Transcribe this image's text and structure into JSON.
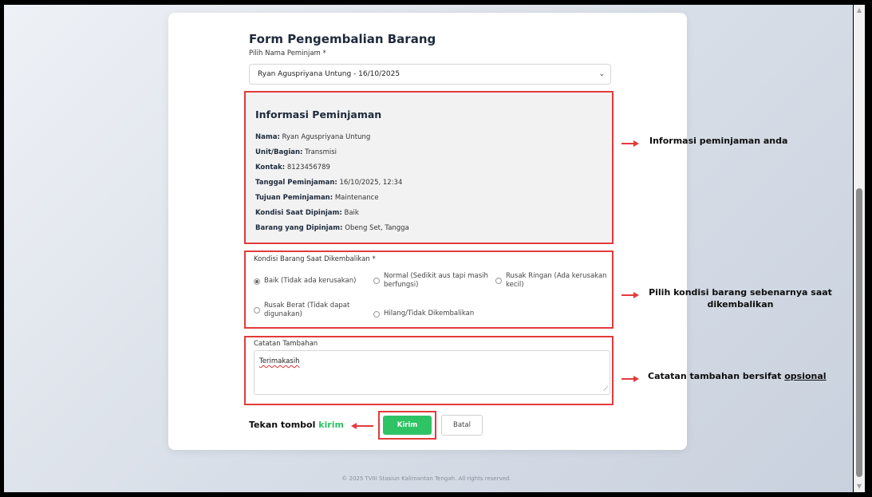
{
  "form": {
    "title": "Form Pengembalian Barang",
    "borrower_label": "Pilih Nama Peminjam *",
    "borrower_selected": "Ryan Aguspriyana Untung - 16/10/2025"
  },
  "info": {
    "title": "Informasi Peminjaman",
    "rows": [
      {
        "label": "Nama:",
        "value": " Ryan Aguspriyana Untung"
      },
      {
        "label": "Unit/Bagian:",
        "value": " Transmisi"
      },
      {
        "label": "Kontak:",
        "value": " 8123456789"
      },
      {
        "label": "Tanggal Peminjaman:",
        "value": " 16/10/2025, 12:34"
      },
      {
        "label": "Tujuan Peminjaman:",
        "value": " Maintenance"
      },
      {
        "label": "Kondisi Saat Dipinjam:",
        "value": " Baik"
      },
      {
        "label": "Barang yang Dipinjam:",
        "value": " Obeng Set, Tangga"
      }
    ]
  },
  "condition": {
    "label": "Kondisi Barang Saat Dikembalikan *",
    "options": [
      {
        "label": "Baik (Tidak ada kerusakan)",
        "checked": true
      },
      {
        "label": "Normal (Sedikit aus tapi masih berfungsi)",
        "checked": false
      },
      {
        "label": "Rusak Ringan (Ada kerusakan kecil)",
        "checked": false
      },
      {
        "label": "Rusak Berat (Tidak dapat digunakan)",
        "checked": false
      },
      {
        "label": "Hilang/Tidak Dikembalikan",
        "checked": false
      }
    ]
  },
  "notes": {
    "label": "Catatan Tambahan",
    "value": "Terimakasih"
  },
  "buttons": {
    "submit": "Kirim",
    "cancel": "Batal"
  },
  "annotations": {
    "info": "Informasi peminjaman anda",
    "condition_line1": "Pilih kondisi barang sebenarnya saat",
    "condition_line2": "dikembalikan",
    "notes_prefix": "Catatan tambahan bersifat ",
    "notes_underlined": "opsional",
    "submit_prefix": "Tekan tombol ",
    "submit_green": "kirim"
  },
  "footer": "© 2025 TVIII Stasiun Kalimantan Tengah. All rights reserved.",
  "colors": {
    "highlight": "#e33b3b",
    "submit_green": "#2ec365"
  }
}
